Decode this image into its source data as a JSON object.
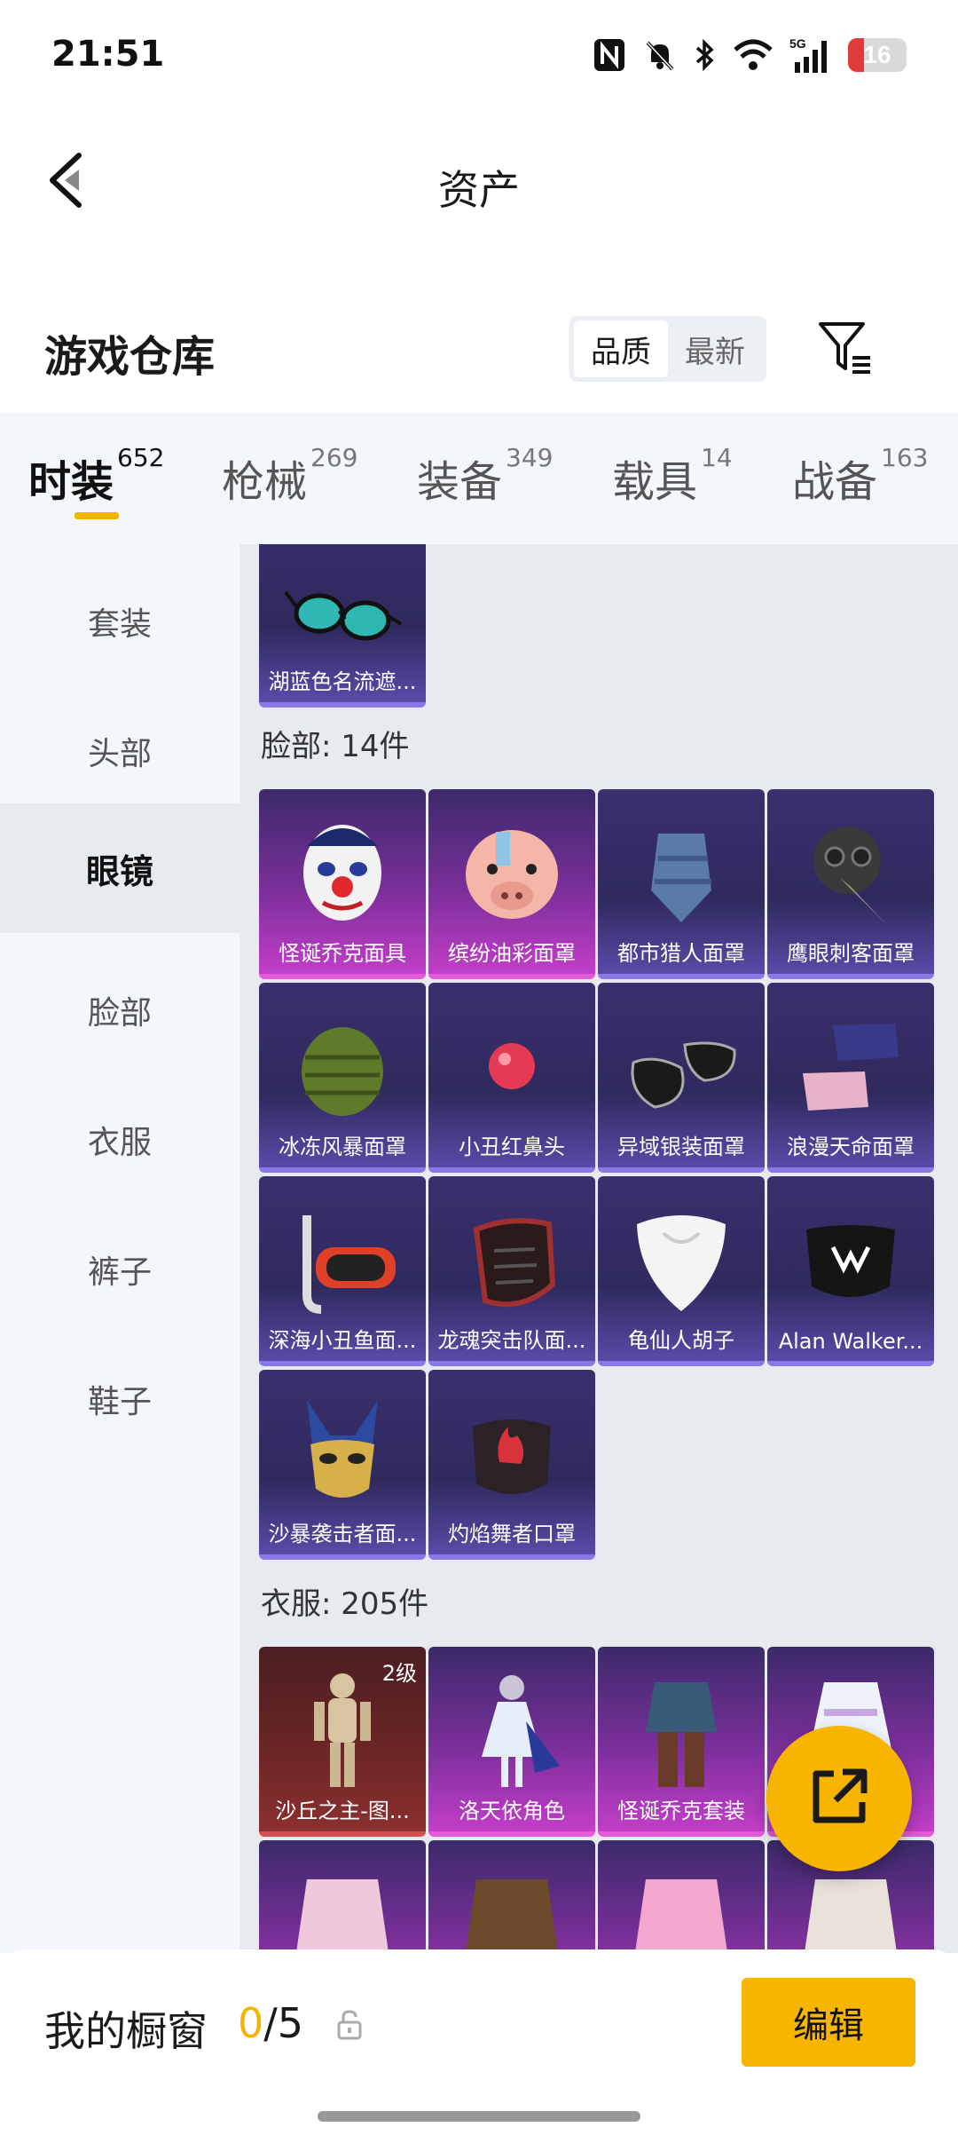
{
  "status_bar": {
    "time": "21:51",
    "network": "5G",
    "battery": "16",
    "icons": [
      "nfc-icon",
      "bell-muted-icon",
      "bluetooth-icon",
      "wifi-icon",
      "signal-icon",
      "battery-icon"
    ]
  },
  "header": {
    "title": "资产"
  },
  "warehouse": {
    "title": "游戏仓库",
    "sort_options": [
      "品质",
      "最新"
    ],
    "active_sort": "品质"
  },
  "tabs": [
    {
      "label": "时装",
      "count": "652"
    },
    {
      "label": "枪械",
      "count": "269"
    },
    {
      "label": "装备",
      "count": "349"
    },
    {
      "label": "载具",
      "count": "14"
    },
    {
      "label": "战备",
      "count": "163"
    }
  ],
  "sidenav": [
    {
      "label": "套装"
    },
    {
      "label": "头部"
    },
    {
      "label": "眼镜"
    },
    {
      "label": "脸部"
    },
    {
      "label": "衣服"
    },
    {
      "label": "裤子"
    },
    {
      "label": "鞋子"
    }
  ],
  "glasses_items": [
    {
      "name": "湖蓝色名流遮..."
    }
  ],
  "face_section": {
    "title": "脸部: 14件",
    "items": [
      {
        "name": "怪诞乔克面具",
        "tier": "pink"
      },
      {
        "name": "缤纷油彩面罩",
        "tier": "pink"
      },
      {
        "name": "都市猎人面罩",
        "tier": "purple"
      },
      {
        "name": "鹰眼刺客面罩",
        "tier": "purple"
      },
      {
        "name": "冰冻风暴面罩",
        "tier": "purple"
      },
      {
        "name": "小丑红鼻头",
        "tier": "purple"
      },
      {
        "name": "异域银装面罩",
        "tier": "purple"
      },
      {
        "name": "浪漫天命面罩",
        "tier": "purple"
      },
      {
        "name": "深海小丑鱼面...",
        "tier": "purple"
      },
      {
        "name": "龙魂突击队面...",
        "tier": "purple"
      },
      {
        "name": "龟仙人胡子",
        "tier": "purple"
      },
      {
        "name": "Alan Walker...",
        "tier": "purple"
      },
      {
        "name": "沙暴袭击者面...",
        "tier": "purple"
      },
      {
        "name": "灼焰舞者口罩",
        "tier": "purple"
      }
    ]
  },
  "clothes_section": {
    "title": "衣服: 205件",
    "items": [
      {
        "name": "沙丘之主-图...",
        "level": "2级",
        "tier": "red"
      },
      {
        "name": "洛天依角色",
        "tier": "pink"
      },
      {
        "name": "怪诞乔克套装",
        "tier": "pink"
      },
      {
        "name": "",
        "tier": "pink"
      }
    ]
  },
  "showcase": {
    "label": "我的橱窗",
    "current": "0",
    "total": "/5",
    "edit_label": "编辑"
  },
  "colors": {
    "accent": "#f7b500",
    "panel": "#e7ebf0",
    "tier_purple": "#8a78e6",
    "tier_pink": "#e45ad8",
    "tier_red": "#d45050"
  }
}
